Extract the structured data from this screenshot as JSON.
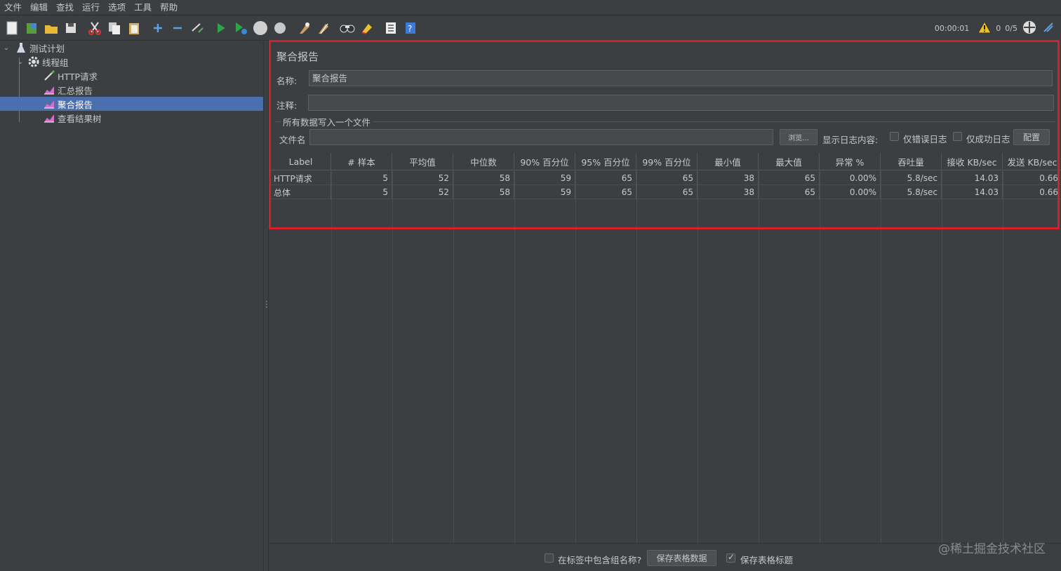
{
  "menu": [
    "文件",
    "编辑",
    "查找",
    "运行",
    "选项",
    "工具",
    "帮助"
  ],
  "toolbar": {
    "timer": "00:00:01",
    "warning_count": "0",
    "threads": "0/5"
  },
  "tree": {
    "items": [
      {
        "label": "测试计划",
        "icon": "flask-icon"
      },
      {
        "label": "线程组",
        "icon": "gear-icon"
      },
      {
        "label": "HTTP请求",
        "icon": "pipette-icon"
      },
      {
        "label": "汇总报告",
        "icon": "chart-icon"
      },
      {
        "label": "聚合报告",
        "icon": "chart-icon",
        "selected": true
      },
      {
        "label": "查看结果树",
        "icon": "chart-icon"
      }
    ]
  },
  "panel": {
    "title": "聚合报告",
    "name_label": "名称:",
    "name_value": "聚合报告",
    "comment_label": "注释:",
    "comment_value": "",
    "group_label": "所有数据写入一个文件",
    "file_label": "文件名",
    "file_value": "",
    "browse_button": "浏览...",
    "log_label": "显示日志内容:",
    "errors_only": "仅错误日志",
    "success_only": "仅成功日志",
    "configure_button": "配置"
  },
  "table": {
    "headers": [
      "Label",
      "# 样本",
      "平均值",
      "中位数",
      "90% 百分位",
      "95% 百分位",
      "99% 百分位",
      "最小值",
      "最大值",
      "异常 %",
      "吞吐量",
      "接收 KB/sec",
      "发送 KB/sec"
    ],
    "rows": [
      [
        "HTTP请求",
        "5",
        "52",
        "58",
        "59",
        "65",
        "65",
        "38",
        "65",
        "0.00%",
        "5.8/sec",
        "14.03",
        "0.66"
      ],
      [
        "总体",
        "5",
        "52",
        "58",
        "59",
        "65",
        "65",
        "38",
        "65",
        "0.00%",
        "5.8/sec",
        "14.03",
        "0.66"
      ]
    ]
  },
  "bottom": {
    "include_group": "在标签中包含组名称?",
    "save_data_button": "保存表格数据",
    "save_header": "保存表格标题"
  },
  "watermark": "@稀土掘金技术社区",
  "colors": {
    "background": "#3c3f41",
    "selection": "#4b6eaf",
    "highlight": "#d61f2b"
  }
}
